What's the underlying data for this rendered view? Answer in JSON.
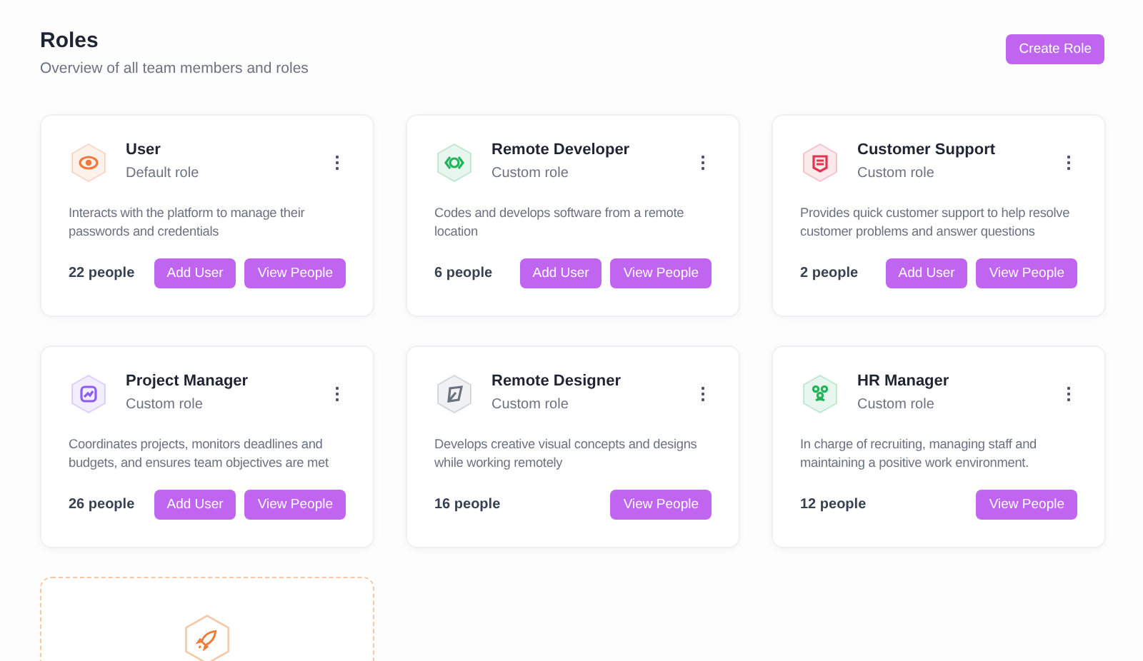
{
  "header": {
    "title": "Roles",
    "subtitle": "Overview of all team members and roles",
    "action": "Create Role"
  },
  "roles": [
    {
      "kind": "eye",
      "name": "User",
      "type": "Default role",
      "description": "Interacts with the platform to manage their passwords and credentials",
      "count": "22 people",
      "buttons": [
        "Add User",
        "View People"
      ]
    },
    {
      "kind": "code",
      "name": "Remote Developer",
      "type": "Custom role",
      "description": "Codes and develops software from a remote location",
      "count": "6 people",
      "buttons": [
        "Add User",
        "View People"
      ]
    },
    {
      "kind": "support",
      "name": "Customer Support",
      "type": "Custom role",
      "description": "Provides quick customer support to help resolve customer problems and answer questions",
      "count": "2 people",
      "buttons": [
        "Add User",
        "View People"
      ]
    },
    {
      "kind": "chart",
      "name": "Project Manager",
      "type": "Custom role",
      "description": "Coordinates projects, monitors deadlines and budgets, and ensures team objectives are met",
      "count": "26 people",
      "buttons": [
        "Add User",
        "View People"
      ]
    },
    {
      "kind": "pen",
      "name": "Remote Designer",
      "type": "Custom role",
      "description": "Develops creative visual concepts and designs while working remotely",
      "count": "16 people",
      "buttons": [
        "View People"
      ]
    },
    {
      "kind": "team",
      "name": "HR Manager",
      "type": "Custom role",
      "description": "In charge of recruiting, managing staff and maintaining a positive work environment.",
      "count": "12 people",
      "buttons": [
        "View People"
      ]
    }
  ]
}
